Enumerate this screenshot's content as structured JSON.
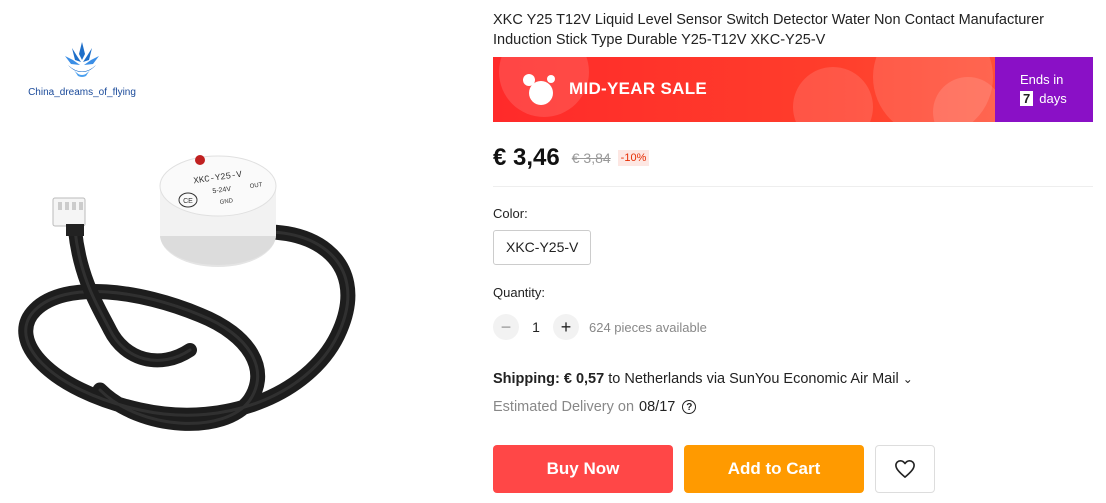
{
  "store": {
    "name": "China_dreams_of_flying"
  },
  "product": {
    "title": "XKC Y25 T12V Liquid Level Sensor Switch Detector Water Non Contact Manufacturer Induction Stick Type Durable Y25-T12V XKC-Y25-V",
    "image_alt": "XKC-Y25-V sensor with cable",
    "sensor_label": {
      "model": "XKC-Y25-V",
      "l1": "5-24V",
      "l2": "OUT",
      "l3": "GND"
    }
  },
  "banner": {
    "label": "MID-YEAR SALE",
    "ends_in_label": "Ends in",
    "days_value": "7",
    "days_unit": "days",
    "colors": {
      "main": "#ff2a2a",
      "timer": "#8a10c6"
    }
  },
  "price": {
    "current": "€ 3,46",
    "original": "€ 3,84",
    "discount": "-10%"
  },
  "color": {
    "label": "Color:",
    "selected": "XKC-Y25-V"
  },
  "quantity": {
    "label": "Quantity:",
    "minus": "−",
    "value": "1",
    "plus": "+",
    "available": "624 pieces available"
  },
  "shipping": {
    "label": "Shipping:",
    "cost": "€ 0,57",
    "text": "to Netherlands via SunYou Economic Air Mail",
    "chevron": "⌄",
    "delivery_label": "Estimated Delivery on",
    "delivery_date": "08/17",
    "help_icon": "question-icon"
  },
  "actions": {
    "buy_now": "Buy Now",
    "add_to_cart": "Add to Cart",
    "wishlist_icon": "heart-icon",
    "buy_color": "#ff4747",
    "cart_color": "#ff9a00"
  }
}
